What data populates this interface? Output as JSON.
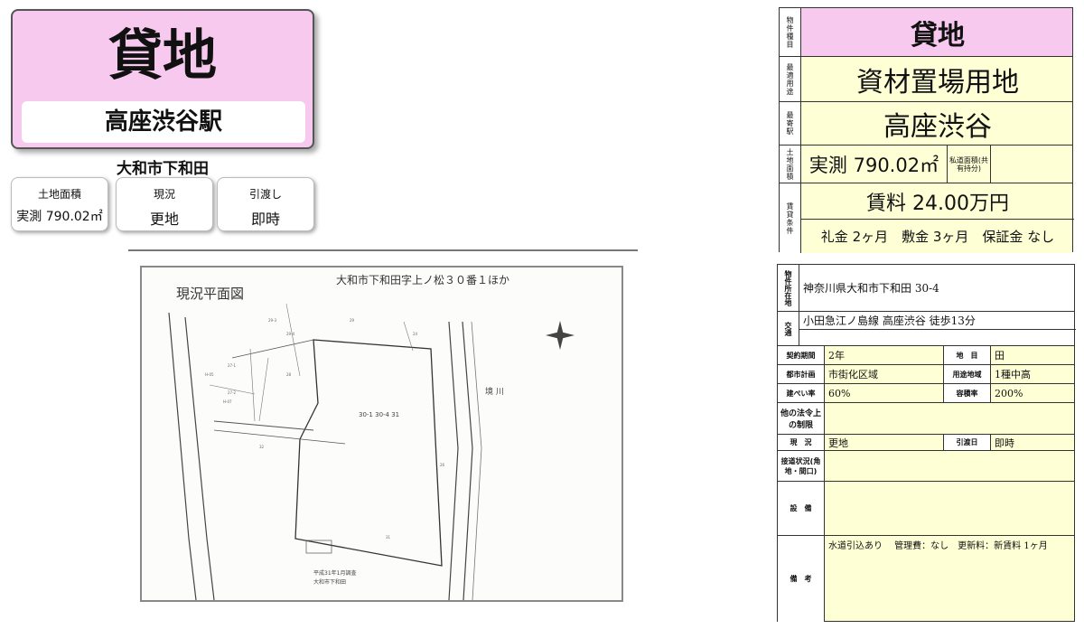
{
  "header": {
    "type": "貸地",
    "station": "高座渋谷駅"
  },
  "address_short": "大和市下和田",
  "cards": [
    {
      "label": "土地面積",
      "value": "実測 790.02㎡"
    },
    {
      "label": "現況",
      "value": "更地"
    },
    {
      "label": "引渡し",
      "value": "即時"
    }
  ],
  "map": {
    "title": "現況平面図",
    "subtitle": "大和市下和田字上ノ松３０番１ほか",
    "lot_label": "30-1 30-4 31",
    "river_label": "境 川",
    "notes": [
      "平成31年1月調査",
      "大和市下和田"
    ]
  },
  "summary": {
    "type_label": "物件種目",
    "type": "貸地",
    "use_label": "最適用途",
    "use": "資材置場用地",
    "station_label": "最寄駅",
    "station": "高座渋谷",
    "area_label": "土地面積",
    "area": "実測 790.02㎡",
    "private_road_label": "私道面積(共有持分)",
    "rent_label": "賃貸条件",
    "rent": "賃料 24.00万円",
    "terms": "礼金 2ヶ月　敷金 3ヶ月　保証金 なし"
  },
  "details": {
    "location_label": "物件所在地",
    "location": "神奈川県大和市下和田 30-4",
    "transport_label": "交通",
    "transport": "小田急江ノ島線 高座渋谷 徒歩13分",
    "contract_label": "契約期間",
    "contract": "2年",
    "landcat_label": "地　目",
    "landcat": "田",
    "planning_label": "都市計画",
    "planning": "市街化区域",
    "zoning_label": "用途地域",
    "zoning": "1種中高",
    "coverage_label": "建ぺい率",
    "coverage": "60%",
    "far_label": "容積率",
    "far": "200%",
    "other_label": "他の法令上の制限",
    "other": "",
    "status_label": "現　況",
    "status": "更地",
    "handover_label": "引渡日",
    "handover": "即時",
    "road_label": "接道状況(角地・間口)",
    "road": "",
    "facilities_label": "設　備",
    "facilities": "",
    "remarks_label": "備　考",
    "remarks": "水道引込あり　 管理費：なし　更新料：新賃料 1ヶ月"
  }
}
